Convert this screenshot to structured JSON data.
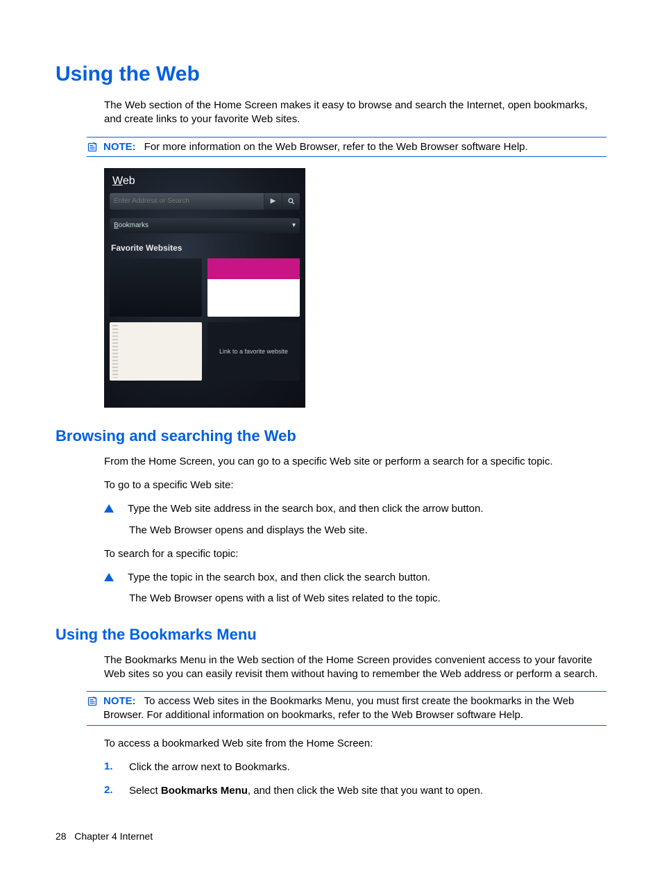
{
  "h1": "Using the Web",
  "intro": "The Web section of the Home Screen makes it easy to browse and search the Internet, open bookmarks, and create links to your favorite Web sites.",
  "note1": {
    "label": "NOTE:",
    "text": "For more information on the Web Browser, refer to the Web Browser software Help."
  },
  "shot": {
    "title_u": "W",
    "title_rest": "eb",
    "search_placeholder": "Enter Address or Search",
    "bookmarks_u": "B",
    "bookmarks_rest": "ookmarks",
    "fav_header": "Favorite Websites",
    "empty_text": "Link to a favorite website"
  },
  "h2a": "Browsing and searching the Web",
  "browsing": {
    "p1": "From the Home Screen, you can go to a specific Web site or perform a search for a specific topic.",
    "p2": "To go to a specific Web site:",
    "b1": "Type the Web site address in the search box, and then click the arrow button.",
    "b1_sub": "The Web Browser opens and displays the Web site.",
    "p3": "To search for a specific topic:",
    "b2": "Type the topic in the search box, and then click the search button.",
    "b2_sub": "The Web Browser opens with a list of Web sites related to the topic."
  },
  "h2b": "Using the Bookmarks Menu",
  "bookmarks": {
    "p1": "The Bookmarks Menu in the Web section of the Home Screen provides convenient access to your favorite Web sites so you can easily revisit them without having to remember the Web address or perform a search.",
    "note": {
      "label": "NOTE:",
      "text": "To access Web sites in the Bookmarks Menu, you must first create the bookmarks in the Web Browser. For additional information on bookmarks, refer to the Web Browser software Help."
    },
    "p2": "To access a bookmarked Web site from the Home Screen:",
    "steps": [
      {
        "n": "1.",
        "text_pre": "Click the arrow next to Bookmarks."
      },
      {
        "n": "2.",
        "text_pre": "Select ",
        "bold": "Bookmarks Menu",
        "text_post": ", and then click the Web site that you want to open."
      }
    ]
  },
  "footer": {
    "page": "28",
    "chapter": "Chapter 4   Internet"
  }
}
